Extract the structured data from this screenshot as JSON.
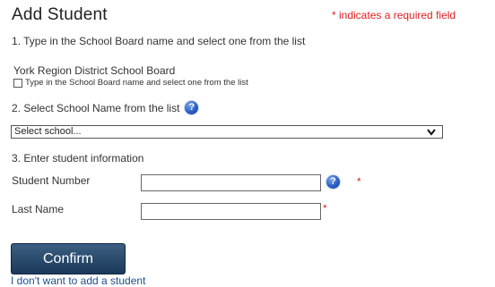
{
  "header": {
    "title": "Add Student",
    "required_note": "* indicates a required field"
  },
  "step1": {
    "label": "1. Type in the School Board name and select one from the list",
    "selected_board": "York Region District School Board",
    "checkbox_label": "Type in the School Board name and select one from the list",
    "checkbox_checked": false
  },
  "step2": {
    "label": "2. Select School Name from the list",
    "select_value": "Select school..."
  },
  "step3": {
    "label": "3. Enter student information",
    "student_number_label": "Student Number",
    "student_number_value": "",
    "last_name_label": "Last Name",
    "last_name_value": "",
    "required_marker": "*"
  },
  "actions": {
    "confirm_label": "Confirm",
    "cancel_link": "I don't want to add a student"
  },
  "icons": {
    "help": "help-icon",
    "dropdown": "chevron-down-icon"
  },
  "colors": {
    "required": "#e02020",
    "confirm_button": "#1c3a5a",
    "link": "#1f4e8c"
  }
}
